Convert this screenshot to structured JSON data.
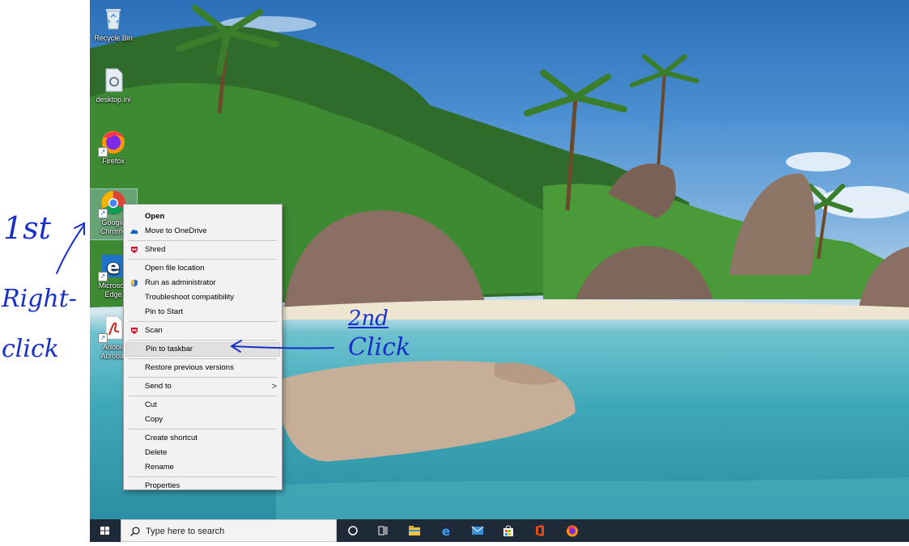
{
  "desktop": {
    "icons": [
      {
        "label": "Recycle Bin",
        "icon": "recycle-bin-icon"
      },
      {
        "label": "desktop.ini",
        "icon": "settings-file-icon"
      },
      {
        "label": "Firefox",
        "icon": "firefox-icon"
      },
      {
        "label": "Google Chrome",
        "icon": "chrome-icon",
        "selected": true
      },
      {
        "label": "Microsoft Edge",
        "icon": "edge-icon"
      },
      {
        "label": "Adobe Acrobat",
        "icon": "acrobat-icon"
      }
    ]
  },
  "context_menu": {
    "items": {
      "open": "Open",
      "onedrive": "Move to OneDrive",
      "shred": "Shred",
      "open_location": "Open file location",
      "run_admin": "Run as administrator",
      "troubleshoot": "Troubleshoot compatibility",
      "pin_start": "Pin to Start",
      "scan": "Scan",
      "pin_taskbar": "Pin to taskbar",
      "restore": "Restore previous versions",
      "send_to": "Send to",
      "cut": "Cut",
      "copy": "Copy",
      "create_shortcut": "Create shortcut",
      "delete": "Delete",
      "rename": "Rename",
      "properties": "Properties"
    },
    "highlighted": "Pin to taskbar"
  },
  "annotations": {
    "first_line1": "1st",
    "first_line2": "Right-",
    "first_line3": "click",
    "second_line1": "2nd",
    "second_line2": "Click"
  },
  "taskbar": {
    "search_placeholder": "Type here to search",
    "pinned": [
      "cortana-icon",
      "task-view-icon",
      "file-explorer-icon",
      "edge-icon",
      "mail-icon",
      "store-icon",
      "office-icon",
      "firefox-icon"
    ]
  },
  "colors": {
    "annotation": "#1830c8",
    "taskbar": "#1f2a38",
    "menu_bg": "#f2f2f2"
  }
}
